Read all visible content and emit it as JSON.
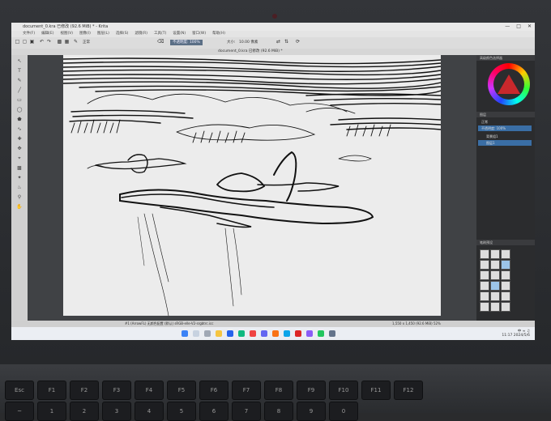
{
  "window": {
    "title": "document_0.kra 已修改 (92.6 MiB) * - Krita"
  },
  "menu": [
    "文件(F)",
    "编辑(E)",
    "视图(V)",
    "图像(I)",
    "图层(L)",
    "选择(S)",
    "滤镜(R)",
    "工具(T)",
    "设置(N)",
    "窗口(W)",
    "帮助(H)"
  ],
  "toolbar": {
    "mode_label": "正常",
    "opacity_field": "不透明度: 100%",
    "size_label": "大小:",
    "size_value": "10.00 像素"
  },
  "document_tab": "document_0.kra 已修改 (92.6 MiB) *",
  "dock": {
    "color_title": "高级颜色选择器",
    "layers_title": "图层",
    "layer_blend": "正常",
    "layer_opacity": "不透明度: 100%",
    "layers": [
      "背景组1",
      "图层1"
    ],
    "presets_title": "笔刷预设"
  },
  "status": {
    "left": "#1 (ArrowFL) 无颜色配置 (默认) sRGB-elle-V2-srgbtrc.icc",
    "right": "1,550 x 1,450 (92.6 MiB) 52%"
  },
  "taskbar": {
    "time": "11:17",
    "date": "2024/5/6",
    "lang": "中"
  },
  "colors": {
    "accent": "#3a6ea5",
    "wheel_triangle": "#c8282c"
  },
  "keyboard": [
    "Esc",
    "F1",
    "F2",
    "F3",
    "F4",
    "F5",
    "F6",
    "F7",
    "F8",
    "F9",
    "F10",
    "F11",
    "F12",
    "~",
    "1",
    "2",
    "3",
    "4",
    "5",
    "6",
    "7",
    "8",
    "9",
    "0"
  ]
}
